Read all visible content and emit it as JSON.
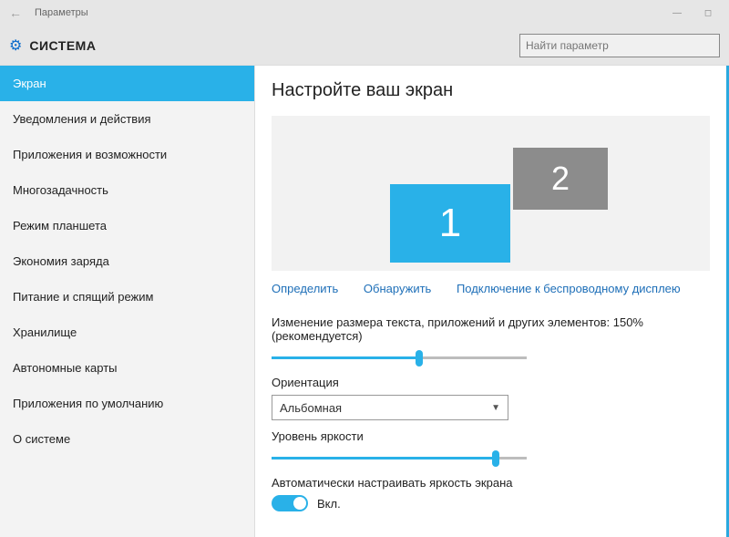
{
  "window": {
    "title": "Параметры"
  },
  "header": {
    "title": "СИСТЕМА",
    "search_placeholder": "Найти параметр"
  },
  "sidebar": {
    "items": [
      "Экран",
      "Уведомления и действия",
      "Приложения и возможности",
      "Многозадачность",
      "Режим планшета",
      "Экономия заряда",
      "Питание и спящий режим",
      "Хранилище",
      "Автономные карты",
      "Приложения по умолчанию",
      "О системе"
    ],
    "active_index": 0
  },
  "main": {
    "title": "Настройте ваш экран",
    "monitors": {
      "m1": "1",
      "m2": "2"
    },
    "links": {
      "identify": "Определить",
      "detect": "Обнаружить",
      "wireless": "Подключение к беспроводному дисплею"
    },
    "scale_label": "Изменение размера текста, приложений и других элементов: 150% (рекомендуется)",
    "scale_slider": {
      "percent": 58
    },
    "orientation_label": "Ориентация",
    "orientation_value": "Альбомная",
    "brightness_label": "Уровень яркости",
    "brightness_slider": {
      "percent": 88
    },
    "auto_brightness_label": "Автоматически настраивать яркость экрана",
    "toggle_on_label": "Вкл."
  }
}
